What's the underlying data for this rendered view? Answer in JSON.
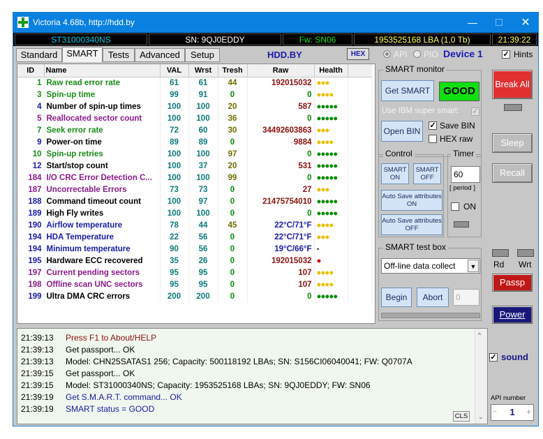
{
  "window": {
    "title": "Victoria 4.68b, http://hdd.by"
  },
  "infobar": {
    "model": "ST31000340NS",
    "serial": "SN: 9QJ0EDDY",
    "firmware": "Fw: SN06",
    "lba": "1953525168 LBA (1,0 Tb)",
    "time": "21:39:22"
  },
  "tabs": [
    "Standard",
    "SMART",
    "Tests",
    "Advanced",
    "Setup"
  ],
  "tabbar": {
    "hddby": "HDD.BY",
    "hex": "HEX",
    "api": "API",
    "pio": "PIO",
    "device": "Device 1",
    "hints": "Hints"
  },
  "table": {
    "headers": [
      "ID",
      "Name",
      "VAL",
      "Wrst",
      "Tresh",
      "Raw",
      "Health"
    ],
    "rows": [
      {
        "id": "1",
        "name": "Raw read error rate",
        "val": "61",
        "wrst": "61",
        "tresh": "44",
        "raw": "192015032",
        "health": "●●●",
        "name_color": "#1a8a1a",
        "health_color": "#e8c000"
      },
      {
        "id": "3",
        "name": "Spin-up time",
        "val": "99",
        "wrst": "91",
        "tresh": "0",
        "raw": "0",
        "health": "●●●●",
        "name_color": "#1a8a1a",
        "health_color": "#e8c000"
      },
      {
        "id": "4",
        "name": "Number of spin-up times",
        "val": "100",
        "wrst": "100",
        "tresh": "20",
        "raw": "587",
        "health": "●●●●●",
        "name_color": "#000000",
        "health_color": "#0a8a0a"
      },
      {
        "id": "5",
        "name": "Reallocated sector count",
        "val": "100",
        "wrst": "100",
        "tresh": "36",
        "raw": "0",
        "health": "●●●●●",
        "name_color": "#8a1a8a",
        "health_color": "#0a8a0a"
      },
      {
        "id": "7",
        "name": "Seek error rate",
        "val": "72",
        "wrst": "60",
        "tresh": "30",
        "raw": "34492603863",
        "health": "●●●",
        "name_color": "#1a8a1a",
        "health_color": "#e8c000"
      },
      {
        "id": "9",
        "name": "Power-on time",
        "val": "89",
        "wrst": "89",
        "tresh": "0",
        "raw": "9884",
        "health": "●●●●",
        "name_color": "#000000",
        "health_color": "#e8c000"
      },
      {
        "id": "10",
        "name": "Spin-up retries",
        "val": "100",
        "wrst": "100",
        "tresh": "97",
        "raw": "0",
        "health": "●●●●●",
        "name_color": "#1a8a1a",
        "health_color": "#0a8a0a"
      },
      {
        "id": "12",
        "name": "Start/stop count",
        "val": "100",
        "wrst": "37",
        "tresh": "20",
        "raw": "531",
        "health": "●●●●●",
        "name_color": "#000000",
        "health_color": "#0a8a0a"
      },
      {
        "id": "184",
        "name": "I/O CRC Error Detection C...",
        "val": "100",
        "wrst": "100",
        "tresh": "99",
        "raw": "0",
        "health": "●●●●●",
        "name_color": "#8a1a8a",
        "health_color": "#0a8a0a"
      },
      {
        "id": "187",
        "name": "Uncorrectable Errors",
        "val": "73",
        "wrst": "73",
        "tresh": "0",
        "raw": "27",
        "health": "●●●",
        "name_color": "#8a1a8a",
        "health_color": "#e8c000"
      },
      {
        "id": "188",
        "name": "Command timeout count",
        "val": "100",
        "wrst": "97",
        "tresh": "0",
        "raw": "21475754010",
        "health": "●●●●●",
        "name_color": "#000000",
        "health_color": "#0a8a0a"
      },
      {
        "id": "189",
        "name": "High Fly writes",
        "val": "100",
        "wrst": "100",
        "tresh": "0",
        "raw": "0",
        "health": "●●●●●",
        "name_color": "#000000",
        "health_color": "#0a8a0a"
      },
      {
        "id": "190",
        "name": "Airflow temperature",
        "val": "78",
        "wrst": "44",
        "tresh": "45",
        "raw": "22°C/71°F",
        "health": "●●●●",
        "name_color": "#1a1aa8",
        "health_color": "#e8c000"
      },
      {
        "id": "194",
        "name": "HDA Temperature",
        "val": "22",
        "wrst": "56",
        "tresh": "0",
        "raw": "22°C/71°F",
        "health": "●●●",
        "name_color": "#1a1aa8",
        "health_color": "#e8c000"
      },
      {
        "id": "194",
        "name": "Minimum temperature",
        "val": "90",
        "wrst": "56",
        "tresh": "0",
        "raw": "19°C/66°F",
        "health": "-",
        "name_color": "#1a1aa8",
        "health_color": "#000000"
      },
      {
        "id": "195",
        "name": "Hardware ECC recovered",
        "val": "35",
        "wrst": "26",
        "tresh": "0",
        "raw": "192015032",
        "health": "●",
        "name_color": "#000000",
        "health_color": "#d01010"
      },
      {
        "id": "197",
        "name": "Current pending sectors",
        "val": "95",
        "wrst": "95",
        "tresh": "0",
        "raw": "107",
        "health": "●●●●",
        "name_color": "#8a1a8a",
        "health_color": "#e8c000"
      },
      {
        "id": "198",
        "name": "Offline scan UNC sectors",
        "val": "95",
        "wrst": "95",
        "tresh": "0",
        "raw": "107",
        "health": "●●●●",
        "name_color": "#8a1a8a",
        "health_color": "#e8c000"
      },
      {
        "id": "199",
        "name": "Ultra DMA CRC errors",
        "val": "200",
        "wrst": "200",
        "tresh": "0",
        "raw": "0",
        "health": "●●●●●",
        "name_color": "#000000",
        "health_color": "#0a8a0a"
      }
    ]
  },
  "smart_monitor": {
    "title": "SMART monitor",
    "get_smart": "Get SMART",
    "status": "GOOD",
    "ibm": "Use IBM super smart:",
    "open_bin": "Open BIN",
    "save_bin": "Save BIN",
    "hex_raw": "HEX raw"
  },
  "control": {
    "title": "Control",
    "smart_on": "SMART ON",
    "smart_off": "SMART OFF",
    "autosave_on": "Auto Save attributes ON",
    "autosave_off": "Auto Save attributes OFF"
  },
  "timer": {
    "title": "Timer",
    "value": "60",
    "period": "[ period ]",
    "on": "ON"
  },
  "testbox": {
    "title": "SMART test box",
    "selected": "Off-line data collect",
    "begin": "Begin",
    "abort": "Abort",
    "field": "0"
  },
  "right": {
    "break_all": "Break All",
    "sleep": "Sleep",
    "recall": "Recall",
    "rd": "Rd",
    "wrt": "Wrt",
    "passp": "Passp",
    "power": "Power",
    "sound": "sound",
    "api_number_label": "API number",
    "api_number": "1"
  },
  "log": {
    "lines": [
      {
        "time": "21:39:13",
        "text": "Press F1 to About/HELP",
        "color": "#8c1010"
      },
      {
        "time": "21:39:13",
        "text": "Get passport... OK",
        "color": "#000000"
      },
      {
        "time": "21:39:13",
        "text": "Model: CHN25SATAS1 256; Capacity: 500118192 LBAs; SN: S156CI06040041; FW: Q0707A",
        "color": "#000000"
      },
      {
        "time": "21:39:15",
        "text": "Get passport... OK",
        "color": "#000000"
      },
      {
        "time": "21:39:15",
        "text": "Model: ST31000340NS; Capacity: 1953525168 LBAs; SN: 9QJ0EDDY; FW: SN06",
        "color": "#000000"
      },
      {
        "time": "21:39:19",
        "text": "Get S.M.A.R.T. command... OK",
        "color": "#1a1aa8"
      },
      {
        "time": "21:39:19",
        "text": "SMART status = GOOD",
        "color": "#1a1aa8"
      }
    ],
    "cls": "CLS"
  }
}
